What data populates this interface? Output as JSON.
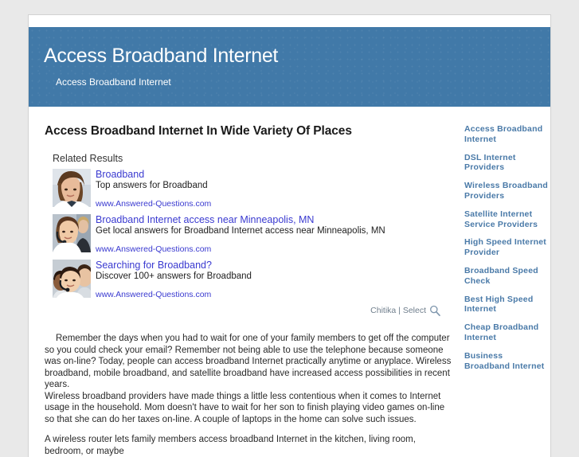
{
  "banner": {
    "title": "Access Broadband Internet",
    "subtitle": "Access Broadband Internet"
  },
  "main": {
    "page_title": "Access Broadband Internet In Wide Variety Of Places",
    "ads_heading": "Related Results",
    "ads": [
      {
        "title": "Broadband",
        "description": "Top answers for Broadband",
        "url": "www.Answered-Questions.com",
        "thumb_alt": "woman-headset-photo"
      },
      {
        "title": "Broadband Internet access near Minneapolis, MN",
        "description": "Get local answers for Broadband Internet access near Minneapolis, MN",
        "url": "www.Answered-Questions.com",
        "thumb_alt": "call-center-woman-photo"
      },
      {
        "title": "Searching for Broadband?",
        "description": "Discover 100+ answers for Broadband",
        "url": "www.Answered-Questions.com",
        "thumb_alt": "call-center-team-photo"
      }
    ],
    "attribution": "Chitika | Select",
    "paragraphs": [
      "Remember the days when you had to wait for one of your family members to get off the computer so you could check your email? Remember not being able to use the telephone because someone was on-line? Today, people can access broadband Internet practically anytime or anyplace. Wireless broadband, mobile broadband, and satellite broadband have increased access possibilities in recent years.",
      "Wireless broadband providers have made things a little less contentious when it comes to Internet usage in the household. Mom doesn't have to wait for her son to finish playing video games on-line so that she can do her taxes on-line. A couple of laptops in the home can solve such issues.",
      "A wireless router lets family members access broadband Internet in the kitchen, living room, bedroom, or maybe"
    ]
  },
  "sidebar": {
    "links": [
      "Access Broadband Internet",
      "DSL Internet Providers",
      "Wireless Broadband Providers",
      "Satellite Internet Service Providers",
      "High Speed Internet Provider",
      "Broadband Speed Check",
      "Best High Speed Internet",
      "Cheap Broadband Internet",
      "Business Broadband Internet"
    ]
  },
  "colors": {
    "banner_blue": "#4179a8",
    "link_blue": "#3a3ad0",
    "sidebar_link": "#4a7aa8",
    "page_background": "#e9e9e9"
  }
}
